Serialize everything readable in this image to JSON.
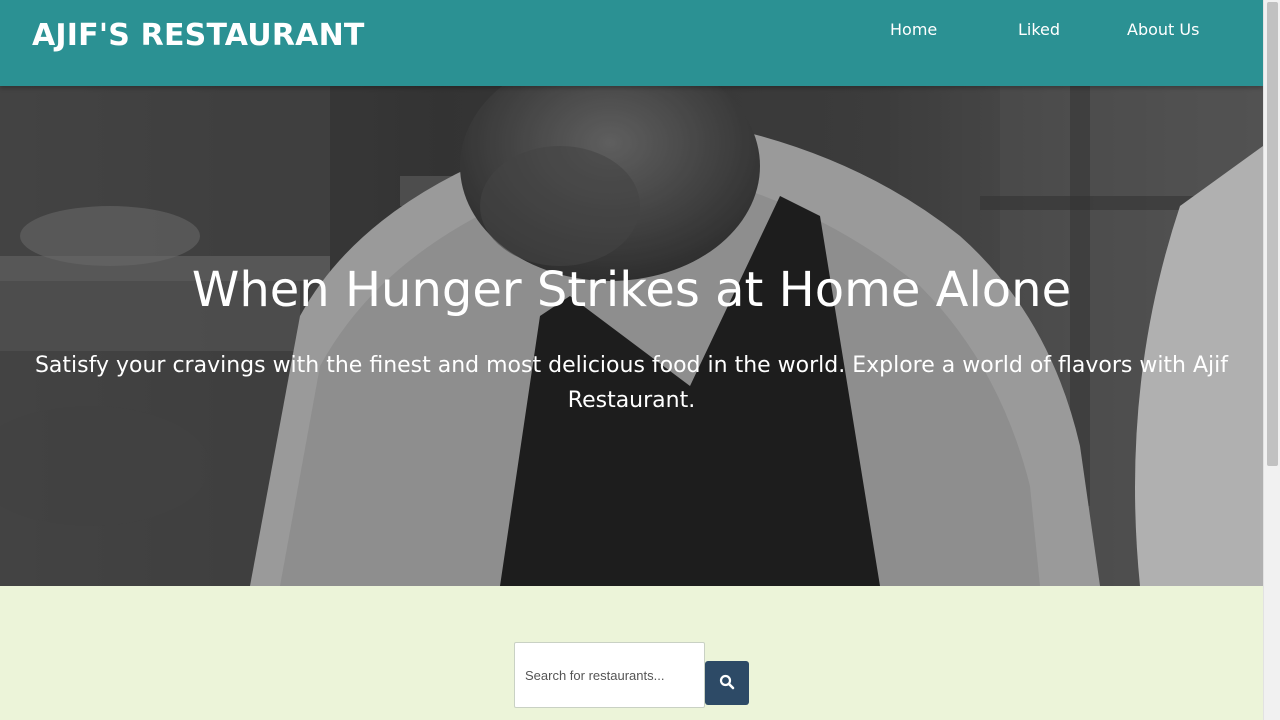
{
  "header": {
    "brand": "AJIF'S RESTAURANT",
    "nav": {
      "home": "Home",
      "liked": "Liked",
      "about": "About Us"
    }
  },
  "hero": {
    "title": "When Hunger Strikes at Home Alone",
    "subtitle": "Satisfy your cravings with the finest and most delicious food in the world. Explore a world of flavors with Ajif Restaurant.",
    "image": "chef-in-kitchen-photo"
  },
  "search": {
    "placeholder": "Search for restaurants...",
    "value": "",
    "button_icon": "search-icon"
  },
  "colors": {
    "header": "#2b9193",
    "page_background": "#ecf4d9",
    "search_button": "#2d4a66"
  }
}
